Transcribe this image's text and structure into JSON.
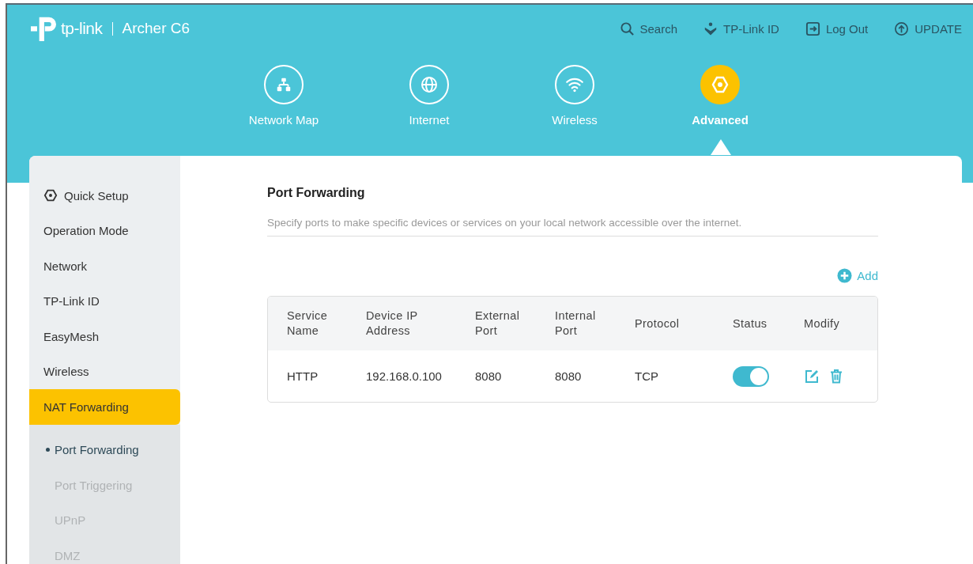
{
  "header": {
    "brand": "tp-link",
    "model": "Archer C6",
    "links": [
      {
        "kind": "search",
        "label": "Search"
      },
      {
        "kind": "id",
        "label": "TP-Link ID"
      },
      {
        "kind": "logout",
        "label": "Log Out"
      },
      {
        "kind": "update",
        "label": "UPDATE"
      }
    ]
  },
  "nav": [
    {
      "kind": "map",
      "label": "Network Map",
      "selected": false
    },
    {
      "kind": "internet",
      "label": "Internet",
      "selected": false
    },
    {
      "kind": "wireless",
      "label": "Wireless",
      "selected": false
    },
    {
      "kind": "advanced",
      "label": "Advanced",
      "selected": true
    }
  ],
  "sidebar": {
    "items": [
      {
        "label": "Quick Setup",
        "kind": "setup",
        "selected": false
      },
      {
        "label": "Operation Mode",
        "selected": false
      },
      {
        "label": "Network",
        "selected": false
      },
      {
        "label": "TP-Link ID",
        "selected": false
      },
      {
        "label": "EasyMesh",
        "selected": false
      },
      {
        "label": "Wireless",
        "selected": false
      },
      {
        "label": "NAT Forwarding",
        "selected": true,
        "children": [
          {
            "label": "Port Forwarding",
            "selected": true
          },
          {
            "label": "Port Triggering",
            "selected": false
          },
          {
            "label": "UPnP",
            "selected": false
          },
          {
            "label": "DMZ",
            "selected": false
          }
        ]
      }
    ]
  },
  "content": {
    "title": "Port Forwarding",
    "description": "Specify ports to make specific devices or services on your local network accessible over the internet.",
    "add_label": "Add",
    "table": {
      "columns": [
        "Service Name",
        "Device IP Address",
        "External Port",
        "Internal Port",
        "Protocol",
        "Status",
        "Modify"
      ],
      "rows": [
        {
          "service_name": "HTTP",
          "device_ip": "192.168.0.100",
          "external_port": "8080",
          "internal_port": "8080",
          "protocol": "TCP",
          "status_on": true
        }
      ]
    }
  }
}
